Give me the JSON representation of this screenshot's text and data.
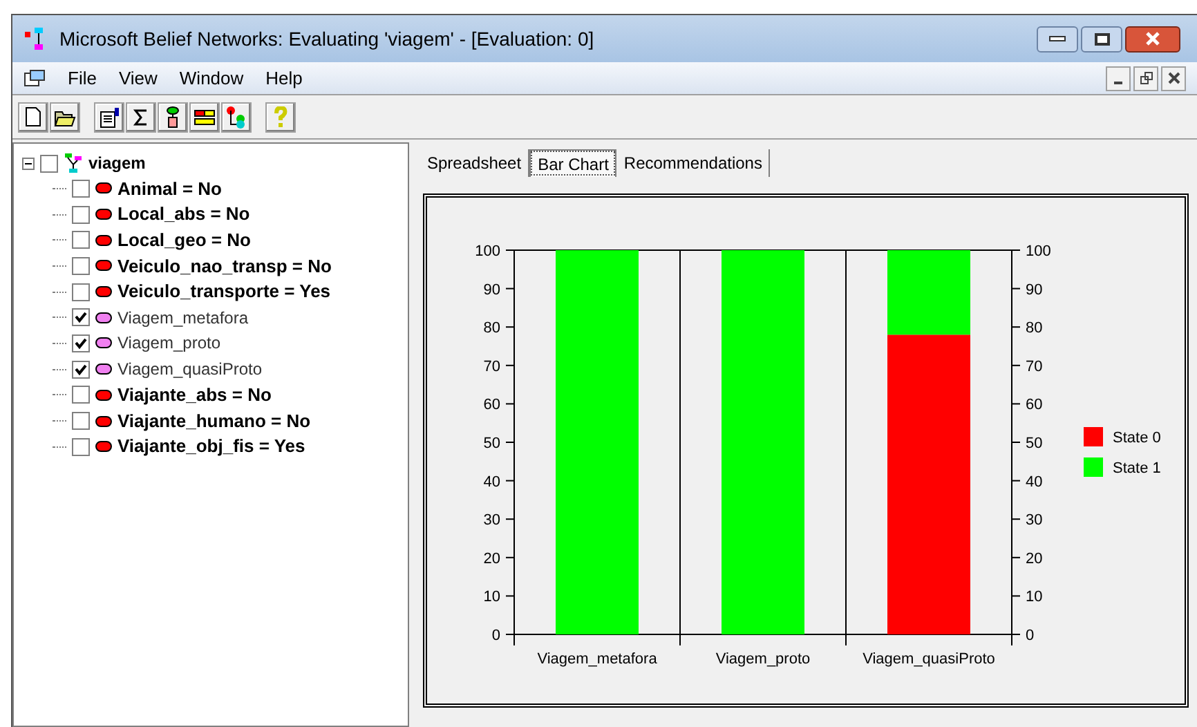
{
  "window": {
    "title": "Microsoft Belief Networks: Evaluating 'viagem' - [Evaluation: 0]"
  },
  "menu": [
    "File",
    "View",
    "Window",
    "Help"
  ],
  "tree": {
    "label": "viagem",
    "expanded": true,
    "checked": false,
    "children": [
      {
        "label": "Animal = No",
        "checked": false
      },
      {
        "label": "Local_abs = No",
        "checked": false
      },
      {
        "label": "Local_geo = No",
        "checked": false
      },
      {
        "label": "Veiculo_nao_transp = No",
        "checked": false
      },
      {
        "label": "Veiculo_transporte = Yes",
        "checked": false
      },
      {
        "label": "Viagem_metafora",
        "checked": true
      },
      {
        "label": "Viagem_proto",
        "checked": true
      },
      {
        "label": "Viagem_quasiProto",
        "checked": true
      },
      {
        "label": "Viajante_abs = No",
        "checked": false
      },
      {
        "label": "Viajante_humano = No",
        "checked": false
      },
      {
        "label": "Viajante_obj_fis = Yes",
        "checked": false
      }
    ]
  },
  "tabs": [
    {
      "label": "Spreadsheet",
      "selected": false
    },
    {
      "label": "Bar Chart",
      "selected": true
    },
    {
      "label": "Recommendations",
      "selected": false
    }
  ],
  "chart_data": {
    "type": "bar",
    "stacked": true,
    "categories": [
      "Viagem_metafora",
      "Viagem_proto",
      "Viagem_quasiProto"
    ],
    "series": [
      {
        "name": "State 0",
        "color": "#ff0000",
        "values": [
          0,
          0,
          78
        ]
      },
      {
        "name": "State 1",
        "color": "#00ff00",
        "values": [
          100,
          100,
          22
        ]
      }
    ],
    "ylim": [
      0,
      100
    ],
    "yticks": [
      0,
      10,
      20,
      30,
      40,
      50,
      60,
      70,
      80,
      90,
      100
    ],
    "y2ticks": [
      0,
      10,
      20,
      30,
      40,
      50,
      60,
      70,
      80,
      90,
      100
    ],
    "y2lim": [
      0,
      100
    ],
    "legend": true
  }
}
